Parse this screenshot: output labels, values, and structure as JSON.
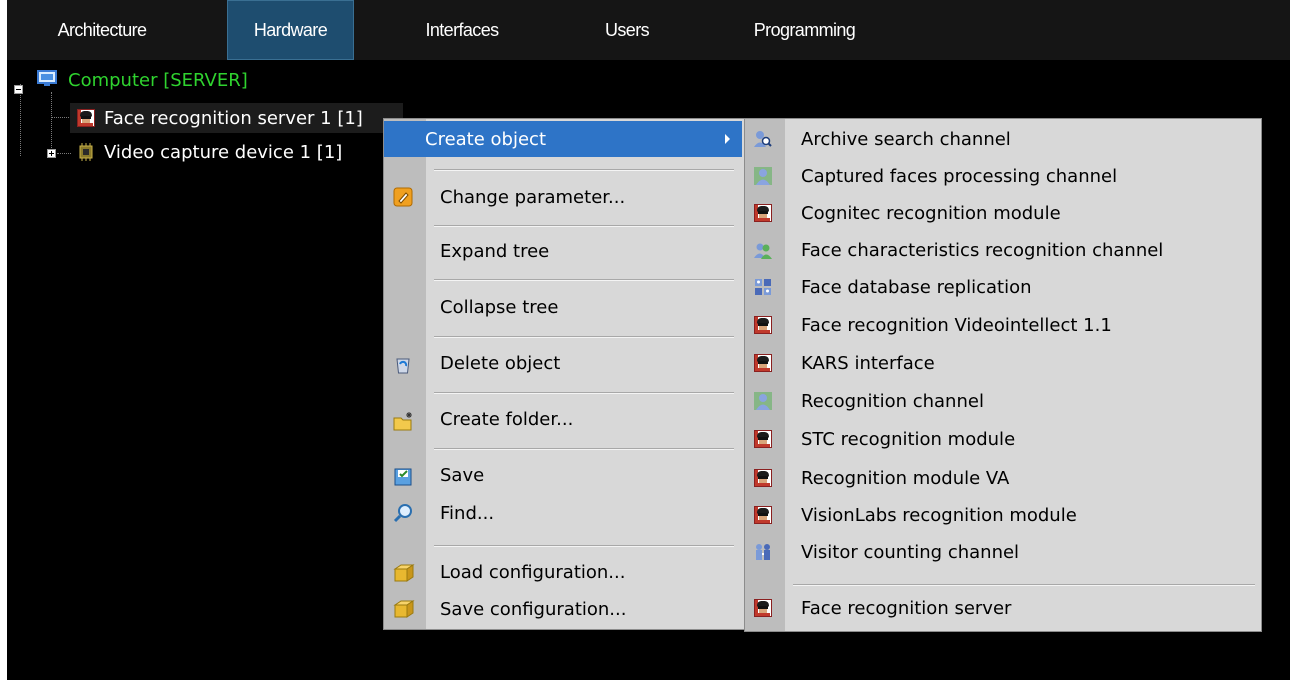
{
  "tabs": [
    {
      "label": "Architecture",
      "active": false
    },
    {
      "label": "Hardware",
      "active": true
    },
    {
      "label": "Interfaces",
      "active": false
    },
    {
      "label": "Users",
      "active": false
    },
    {
      "label": "Programming",
      "active": false
    }
  ],
  "tree": {
    "root": {
      "label": "Computer [SERVER]",
      "color": "#2fd32f",
      "icon": "monitor-icon",
      "expanded": true
    },
    "children": [
      {
        "label": "Face recognition server 1 [1]",
        "icon": "face-recognition-icon",
        "selected": true
      },
      {
        "label": "Video capture device 1 [1]",
        "icon": "capture-device-icon",
        "expanded": false
      }
    ]
  },
  "context_menu": {
    "items": [
      {
        "label": "Create object",
        "highlighted": true,
        "has_submenu": true
      },
      {
        "label": "Change parameter...",
        "icon": "edit-parameter-icon"
      },
      {
        "label": "Expand tree"
      },
      {
        "label": "Collapse tree"
      },
      {
        "label": "Delete object",
        "icon": "recycle-bin-icon"
      },
      {
        "label": "Create folder...",
        "icon": "new-folder-icon"
      },
      {
        "label": "Save",
        "icon": "save-icon"
      },
      {
        "label": "Find...",
        "icon": "magnifier-icon"
      },
      {
        "label": "Load configuration...",
        "icon": "load-box-icon"
      },
      {
        "label": "Save configuration...",
        "icon": "save-box-icon"
      }
    ],
    "highlight_color": "#2e74c7"
  },
  "submenu": {
    "items": [
      {
        "label": "Archive search channel",
        "icon": "archive-search-icon"
      },
      {
        "label": "Captured faces processing channel",
        "icon": "person-icon"
      },
      {
        "label": "Cognitec recognition module",
        "icon": "face-recognition-icon"
      },
      {
        "label": "Face characteristics recognition channel",
        "icon": "persons-icon"
      },
      {
        "label": "Face database replication",
        "icon": "database-replication-icon"
      },
      {
        "label": "Face recognition Videointellect 1.1",
        "icon": "face-recognition-icon"
      },
      {
        "label": "KARS interface",
        "icon": "face-recognition-icon"
      },
      {
        "label": "Recognition channel",
        "icon": "person-icon"
      },
      {
        "label": "STC recognition module",
        "icon": "face-recognition-icon"
      },
      {
        "label": "Recognition module VA",
        "icon": "face-recognition-icon"
      },
      {
        "label": "VisionLabs recognition module",
        "icon": "face-recognition-icon"
      },
      {
        "label": "Visitor counting channel",
        "icon": "visitor-counter-icon"
      },
      {
        "label": "Face recognition server",
        "icon": "face-recognition-icon"
      }
    ]
  }
}
